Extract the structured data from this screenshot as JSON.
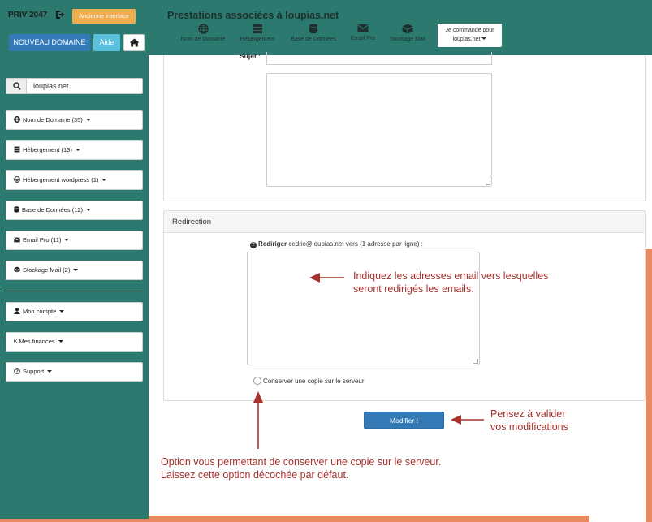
{
  "header": {
    "account_id": "PRIV-2047",
    "old_interface_label": "Ancienne interface",
    "new_domain_label": "NOUVEAU DOMAINE",
    "help_label": "Aide",
    "page_title": "Prestations associées à loupias.net",
    "nav": [
      {
        "label": "Nom de Domaine",
        "icon": "globe-icon"
      },
      {
        "label": "Hébergement",
        "icon": "server-icon"
      },
      {
        "label": "Base de Données",
        "icon": "database-icon"
      },
      {
        "label": "Email Pro",
        "icon": "envelope-icon"
      },
      {
        "label": "Stockage Mail",
        "icon": "box-icon"
      }
    ],
    "order_line1": "Je commande pour",
    "order_line2": "loupias.net"
  },
  "sidebar": {
    "search_value": "loupias.net",
    "items": [
      {
        "label": "Nom de Domaine (35)",
        "icon": "globe-icon"
      },
      {
        "label": "Hébergement (13)",
        "icon": "server-icon"
      },
      {
        "label": "Hébergement wordpress (1)",
        "icon": "wordpress-icon"
      },
      {
        "label": "Base de Données (12)",
        "icon": "database-icon"
      },
      {
        "label": "Email Pro (11)",
        "icon": "envelope-icon"
      },
      {
        "label": "Stockage Mail (2)",
        "icon": "box-icon"
      }
    ],
    "account_items": [
      {
        "label": "Mon compte",
        "icon": "user-icon"
      },
      {
        "label": "Mes finances",
        "icon": "euro-icon"
      },
      {
        "label": "Support",
        "icon": "question-icon"
      }
    ]
  },
  "form": {
    "subject_label": "Sujet :",
    "redirection_title": "Redirection",
    "redirect_label_bold": "Rediriger",
    "redirect_label_rest": " cedric@loupias.net vers (1 adresse par ligne) :",
    "keep_copy_label": "Conserver une copie sur le serveur",
    "submit_label": "Modifier !"
  },
  "annotations": {
    "redirect_hint": [
      "Indiquez les adresses email vers lesquelles",
      "seront redirigés les emails."
    ],
    "validate_hint": [
      "Pensez à valider",
      "vos modifications"
    ],
    "copy_hint": [
      "Option vous permettant de conserver une copie sur le serveur.",
      "Laissez cette option décochée par défaut."
    ]
  },
  "colors": {
    "teal": "#2c7a6f",
    "primary": "#337ab7",
    "warning": "#f0ad4e",
    "info": "#5bc0de",
    "annotation": "#a8322d",
    "accent_bar": "#e78a5f"
  }
}
